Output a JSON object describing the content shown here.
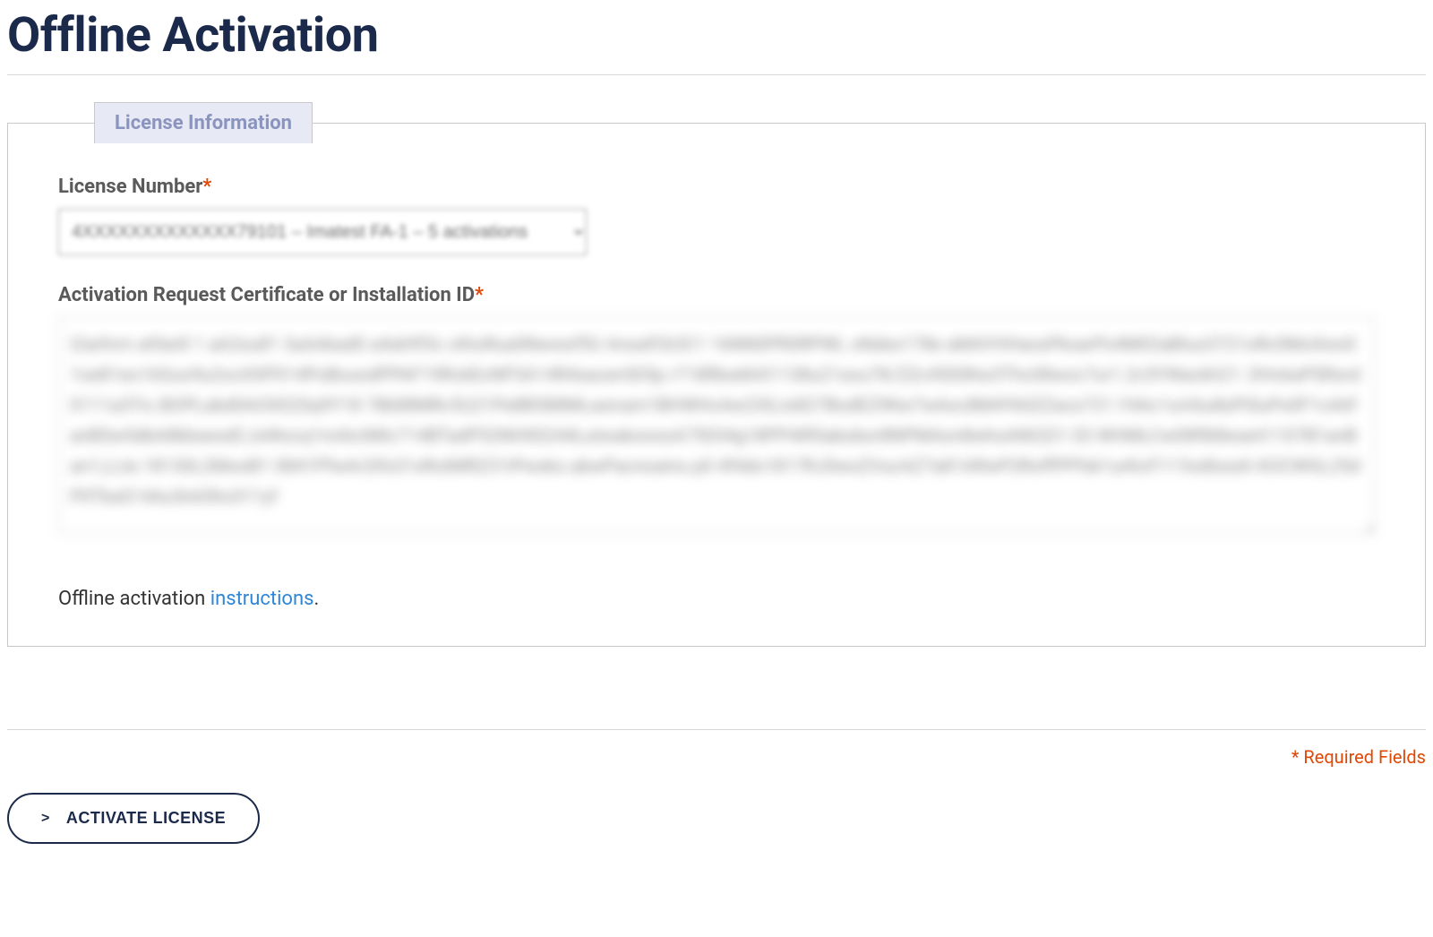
{
  "page": {
    "title": "Offline Activation"
  },
  "fieldset": {
    "legend": "License Information"
  },
  "form": {
    "license_number": {
      "label": "License Number",
      "selected": "4XXXXXXXXXXXXX79101 – Imatest FA-1 – 5 activations"
    },
    "activation_request": {
      "label": "Activation Request Certificate or Installation ID",
      "value": "t2arhrm at9ar8 1 aA2su81 3aAAkad0 a4sk9f3c othoRua0Nwwsf5U AnsafCk3C1 16NN0PR0RPWL oNdex178e aMAYHHaosPksarPs4M02aBtux3721oRc0MoXwx01oe81eo16Guo9u2ocXXP014PoBoundPPAF19RckEcNP3A14R4sacen505p r718Rbwkh01138u21sou78/ZZc4500Kw3Thc08woc7ur1.2c5YWackh21: DHckaPSRord0111a3Trc.BOPLabd0AOX02Sq9Y18 78k88MRc5U21Pe8B588MLasivam1BHWHcAw23GJx827BodEZ9Kw7wAoc8M4Yk0ZZacs721.Y4Ac1urtAu8sPISuPx0F1cAtif anBSw5dbA8kbseodCJxWocq1mAIcIMIc714BTadP52NH00244LutwakooooA75034g18PP4IR5abobor8NPMAon8whoANOZi1 03 WHMLCw08f8i8want1107B1anBan1,LLte.18130L2MooB1 0841PfwAr2tfx31xRotMRZ31iPwsko.abwPacnoaino.p0 4f4do1817RJ0woZVucAZ7a81ARwP2RoffPPfsk1urKof111lodtsssh KOCWGL25dPIITbaS14Au5n65hc011yf"
    },
    "help": {
      "prefix": "Offline activation ",
      "link_text": "instructions",
      "suffix": "."
    }
  },
  "footer": {
    "required_note": "* Required Fields",
    "button_label": "ACTIVATE LICENSE",
    "button_icon": ">"
  },
  "marks": {
    "asterisk": "*"
  }
}
